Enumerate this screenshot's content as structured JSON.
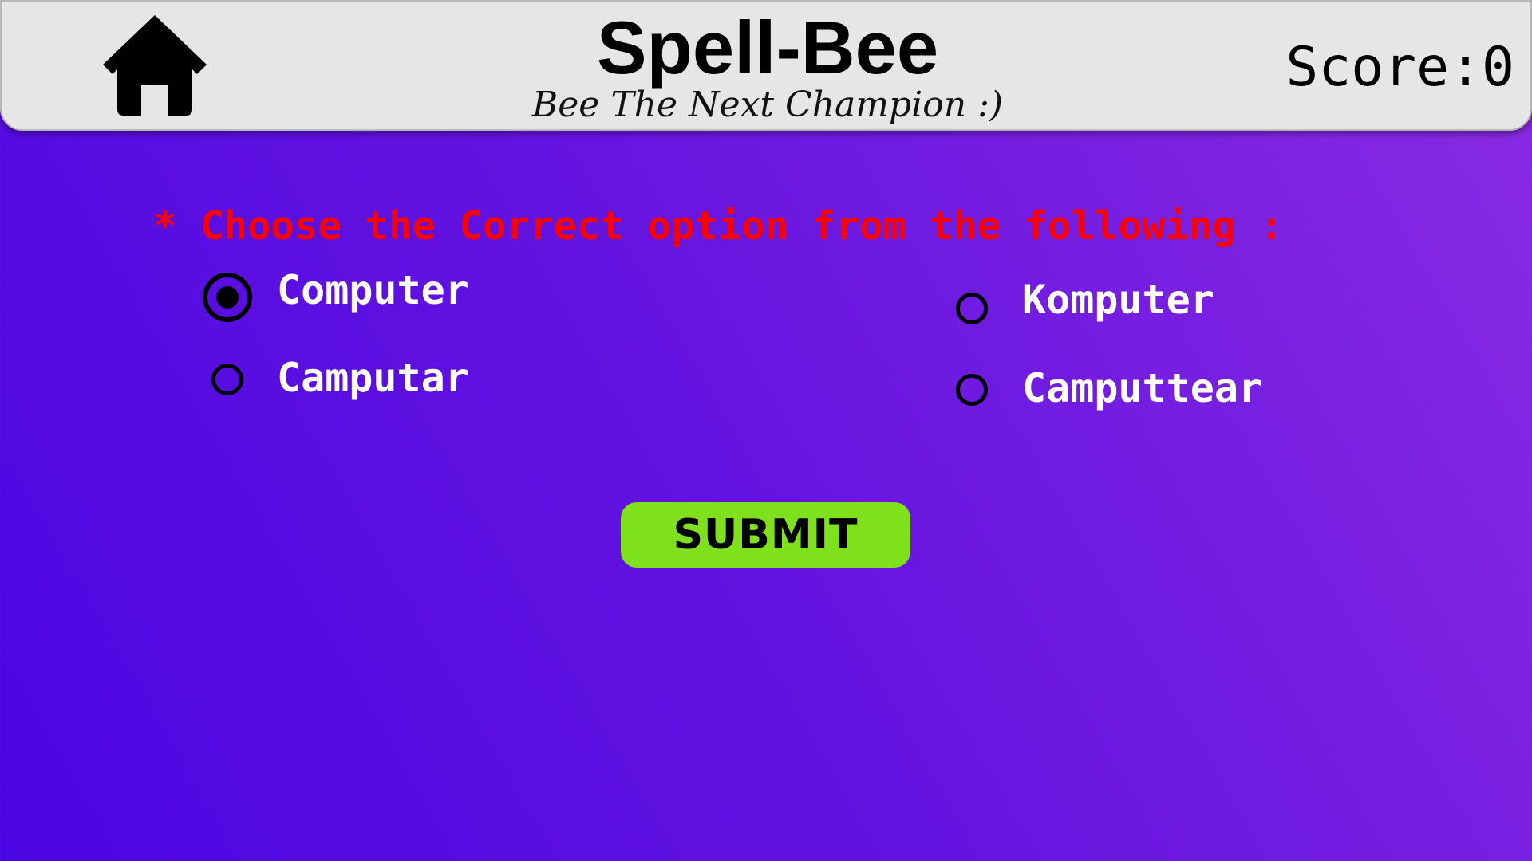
{
  "header": {
    "title": "Spell-Bee",
    "subtitle": "Bee The Next Champion :)",
    "score_label": "Score:0",
    "home_icon": "home-icon"
  },
  "quiz": {
    "question": "* Choose the Correct option from the following :",
    "options": [
      {
        "label": "Computer",
        "selected": true
      },
      {
        "label": "Komputer",
        "selected": false
      },
      {
        "label": "Camputar",
        "selected": false
      },
      {
        "label": "Camputtear",
        "selected": false
      }
    ],
    "submit_label": "SUBMIT"
  },
  "colors": {
    "header_bg": "#e6e6e6",
    "question_text": "#ff0000",
    "option_text": "#ffffff",
    "submit_bg": "#7fe11b",
    "background_start": "#4a06e2",
    "background_end": "#8a2be2"
  }
}
